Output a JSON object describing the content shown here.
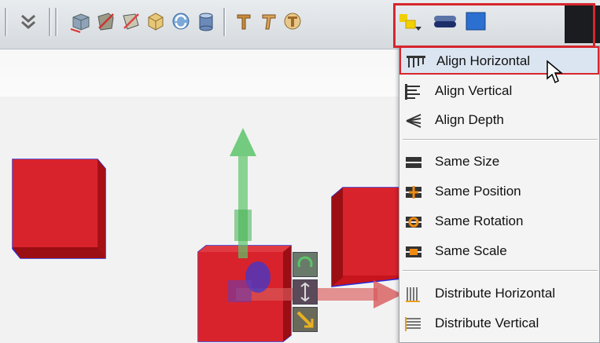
{
  "toolbar": {
    "icons": [
      "chevron-double-down-icon",
      "box-icon",
      "deform-icon",
      "bend-icon",
      "taper-icon",
      "twist-icon",
      "cylinder-icon",
      "text-t-icon",
      "text-twist-icon",
      "text-3d-icon",
      "align-icon",
      "capsule-icon",
      "blue-square-icon"
    ]
  },
  "align_menu": {
    "items": [
      {
        "label": "Align Horizontal",
        "icon": "align-horizontal-icon",
        "active": true
      },
      {
        "label": "Align Vertical",
        "icon": "align-vertical-icon",
        "active": false
      },
      {
        "label": "Align Depth",
        "icon": "align-depth-icon",
        "active": false
      },
      {
        "label": "Same Size",
        "icon": "same-size-icon",
        "active": false
      },
      {
        "label": "Same Position",
        "icon": "same-position-icon",
        "active": false
      },
      {
        "label": "Same Rotation",
        "icon": "same-rotation-icon",
        "active": false
      },
      {
        "label": "Same Scale",
        "icon": "same-scale-icon",
        "active": false
      },
      {
        "label": "Distribute Horizontal",
        "icon": "distribute-horizontal-icon",
        "active": false
      },
      {
        "label": "Distribute Vertical",
        "icon": "distribute-vertical-icon",
        "active": false
      }
    ]
  },
  "colors": {
    "highlight": "#d6262d",
    "cube": "#c8141c",
    "selection_outline": "#2a2ad8",
    "gizmo_y": "#5cc46a",
    "gizmo_x": "#d85a5a",
    "gizmo_z": "#3a3ad0"
  },
  "viewport": {
    "cursor_icon": "mouse-pointer-icon"
  }
}
